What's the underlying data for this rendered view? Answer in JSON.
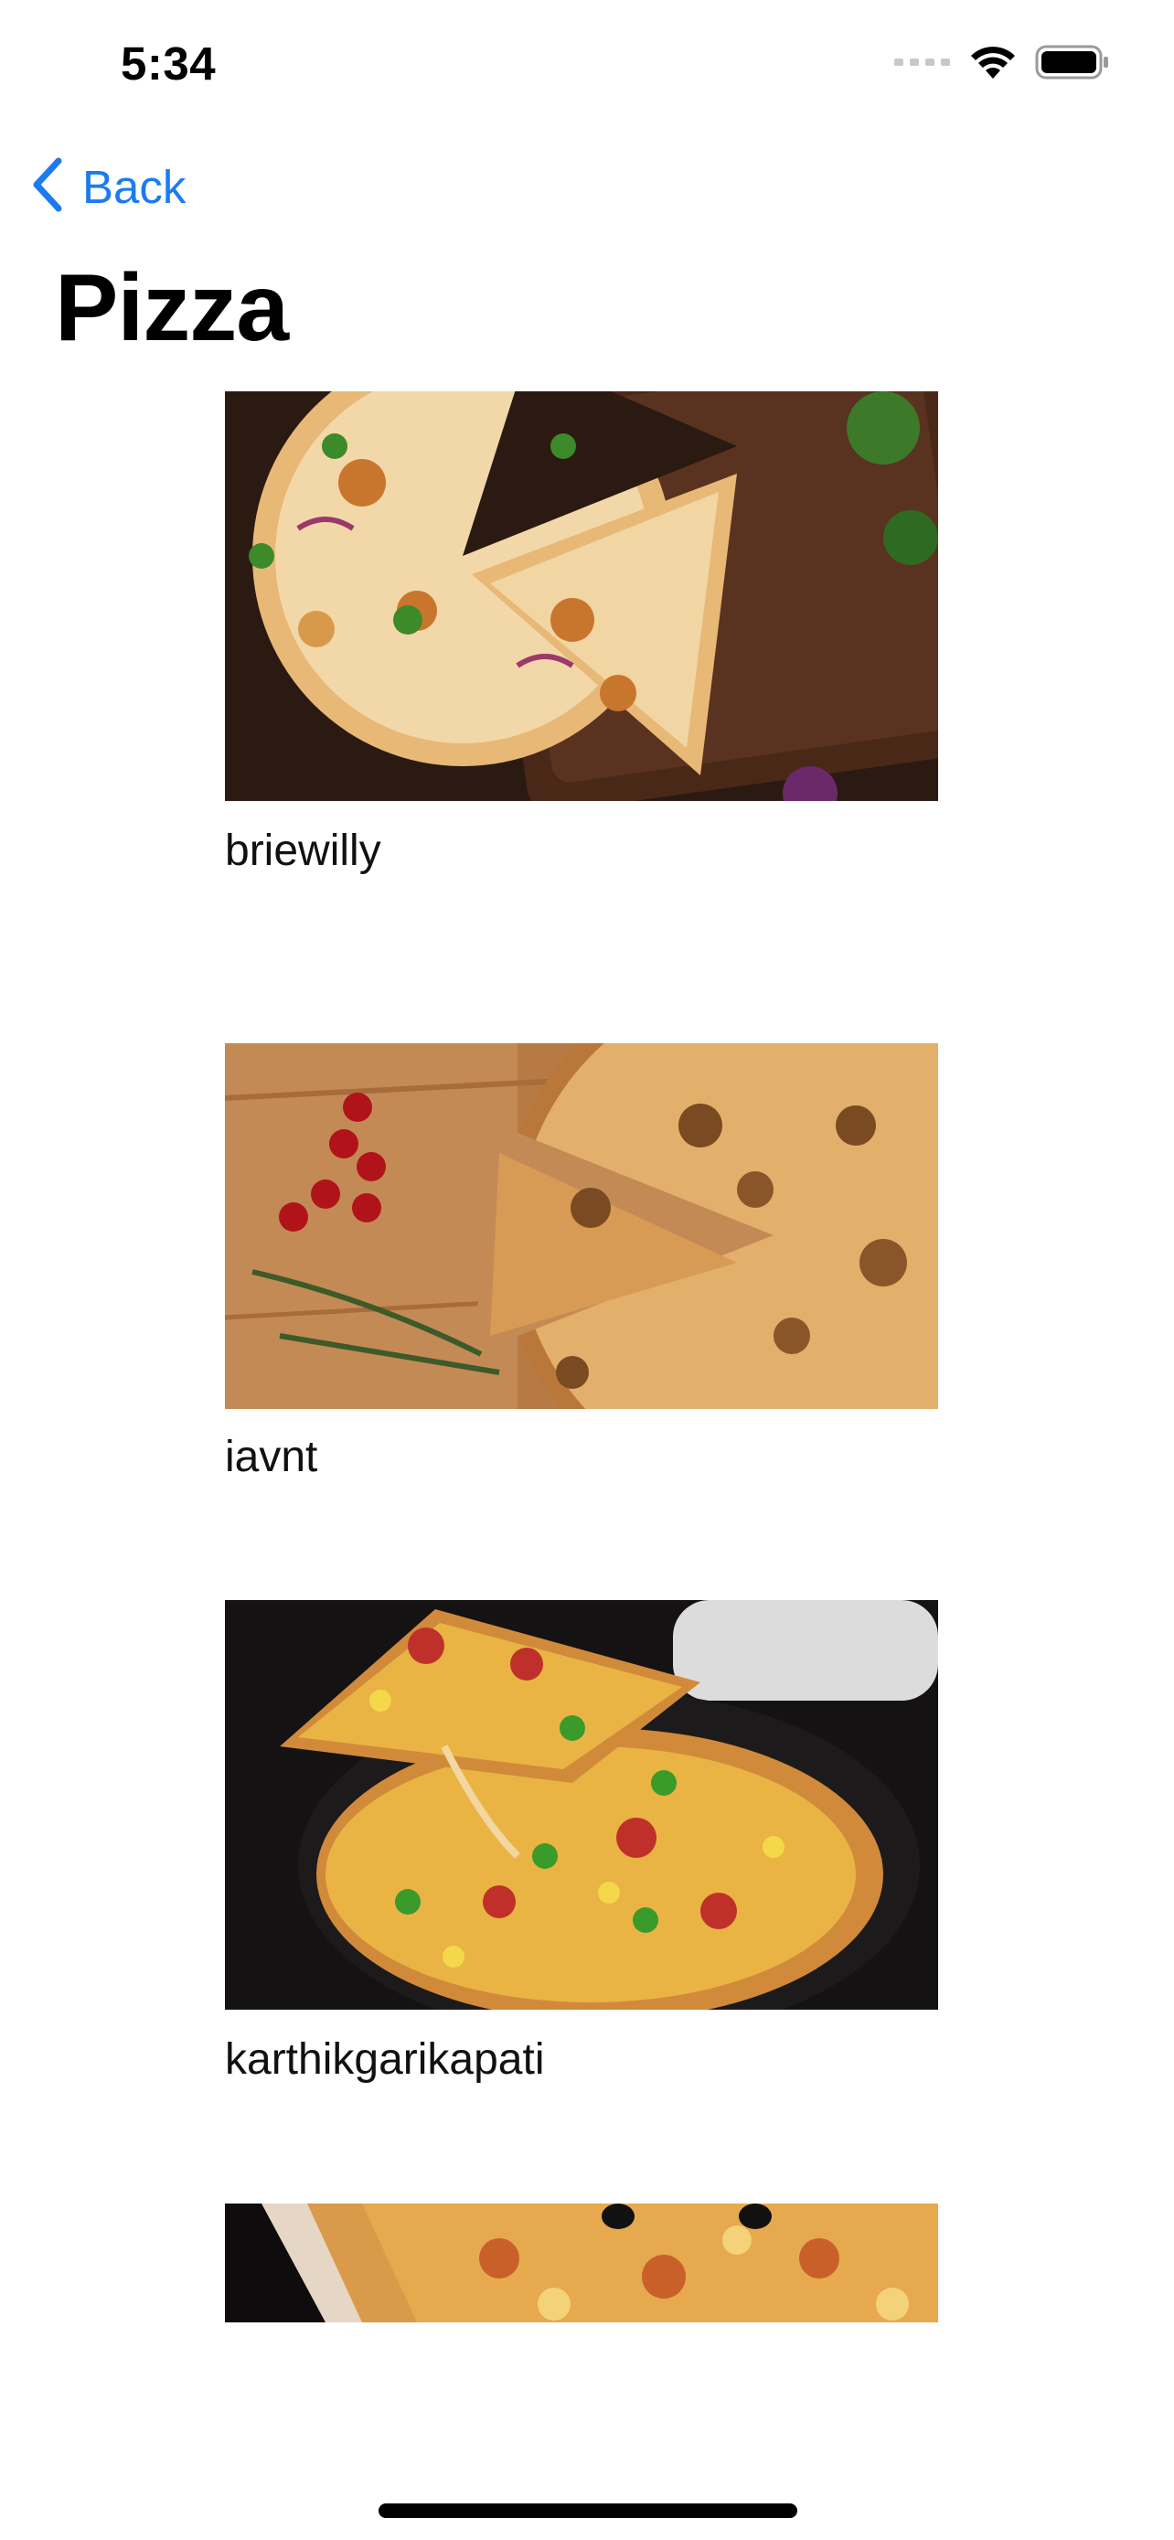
{
  "status_bar": {
    "time": "5:34"
  },
  "nav": {
    "back_label": "Back",
    "title": "Pizza"
  },
  "colors": {
    "accent": "#1a7cf0",
    "background": "#ffffff"
  },
  "posts": [
    {
      "author": "briewilly",
      "image": "pizza-on-wooden-board-photo"
    },
    {
      "author": "iavnt",
      "image": "pizza-with-cherry-tomatoes-photo"
    },
    {
      "author": "karthikgarikapati",
      "image": "pizza-slice-lifted-photo"
    },
    {
      "author": "",
      "image": "pizza-partial-photo"
    }
  ]
}
